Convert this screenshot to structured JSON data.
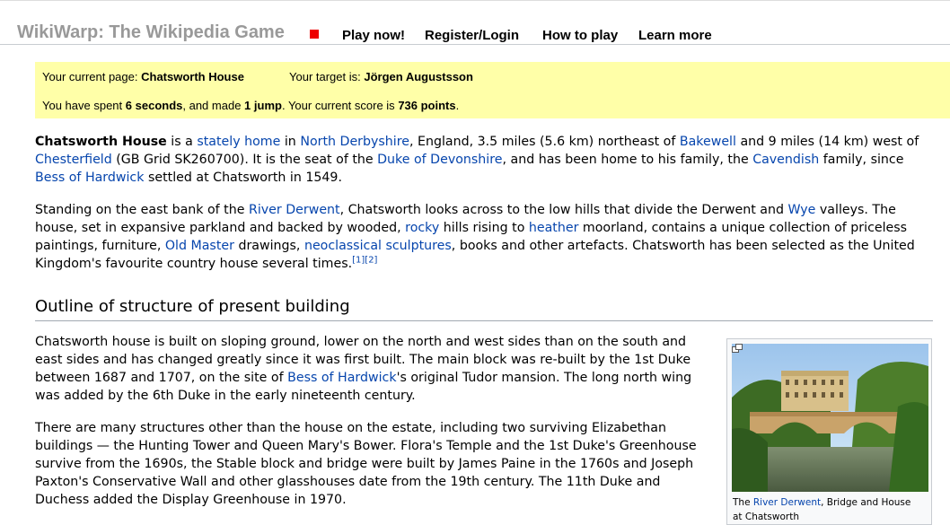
{
  "header": {
    "site_title": "WikiWarp: The Wikipedia Game",
    "nav": [
      "Play now!",
      "Register/Login",
      "How to play",
      "Learn more"
    ]
  },
  "status": {
    "current_label": "Your current page:",
    "current_page": "Chatsworth House",
    "target_label": "Your target is:",
    "target_page": "Jörgen Augustsson",
    "spent_prefix": "You have spent",
    "seconds": "6 seconds",
    "made_text": ", and made",
    "jumps": "1 jump",
    "score_prefix": ". Your current score is",
    "score": "736 points",
    "score_suffix": "."
  },
  "article": {
    "p1": {
      "bold_title": "Chatsworth House",
      "t1": " is a ",
      "l_stately": "stately home",
      "t2": " in ",
      "l_north_derbyshire": "North Derbyshire",
      "t3": ", England, 3.5 miles (5.6 km) northeast of ",
      "l_bakewell": "Bakewell",
      "t4": " and 9 miles (14 km) west of ",
      "l_chesterfield": "Chesterfield",
      "t5": " (GB Grid SK260700). It is the seat of the ",
      "l_duke": "Duke of Devonshire",
      "t6": ", and has been home to his family, the ",
      "l_cavendish": "Cavendish",
      "t7": " family, since ",
      "l_bess": "Bess of Hardwick",
      "t8": " settled at Chatsworth in 1549."
    },
    "p2": {
      "t1": "Standing on the east bank of the ",
      "l_river": "River Derwent",
      "t2": ", Chatsworth looks across to the low hills that divide the Derwent and ",
      "l_wye": "Wye",
      "t3": " valleys. The house, set in expansive parkland and backed by wooded, ",
      "l_rocky": "rocky",
      "t4": " hills rising to ",
      "l_heather": "heather",
      "t5": " moorland, contains a unique collection of priceless paintings, furniture, ",
      "l_old_master": "Old Master",
      "t6": " drawings, ",
      "l_neoclassical": "neoclassical sculptures",
      "t7": ", books and other artefacts. Chatsworth has been selected as the United Kingdom's favourite country house several times.",
      "ref1": "[1]",
      "ref2": "[2]"
    },
    "section_heading": "Outline of structure of present building",
    "p3": {
      "t1": "Chatsworth house is built on sloping ground, lower on the north and west sides than on the south and east sides and has changed greatly since it was first built. The main block was re-built by the 1st Duke between 1687 and 1707, on the site of ",
      "l_bess": "Bess of Hardwick",
      "t2": "'s original Tudor mansion. The long north wing was added by the 6th Duke in the early nineteenth century."
    },
    "p4": "There are many structures other than the house on the estate, including two surviving Elizabethan buildings — the Hunting Tower and Queen Mary's Bower. Flora's Temple and the 1st Duke's Greenhouse survive from the 1690s, the Stable block and bridge were built by James Paine in the 1760s and Joseph Paxton's Conservative Wall and other glasshouses date from the 19th century. The 11th Duke and Duchess added the Display Greenhouse in 1970.",
    "caption": {
      "t1": "The ",
      "link": "River Derwent",
      "t2": ", Bridge and House at Chatsworth"
    }
  },
  "colors": {
    "link": "#0645ad",
    "status_bg": "#ffffa8",
    "title_gray": "#999999",
    "accent_red": "#ee0000"
  }
}
